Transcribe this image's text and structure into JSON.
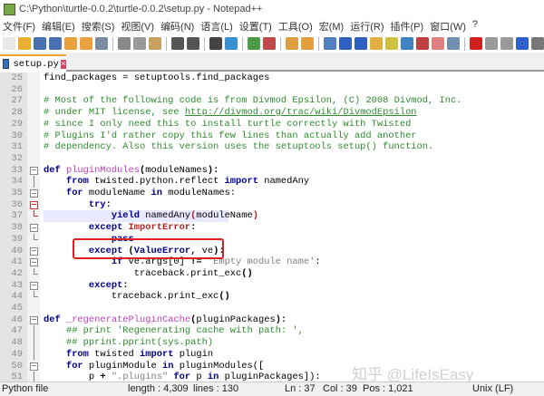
{
  "window": {
    "title": "C:\\Python\\turtle-0.0.2\\turtle-0.0.2\\setup.py - Notepad++"
  },
  "menu": [
    "文件(F)",
    "编辑(E)",
    "搜索(S)",
    "视图(V)",
    "编码(N)",
    "语言(L)",
    "设置(T)",
    "工具(O)",
    "宏(M)",
    "运行(R)",
    "插件(P)",
    "窗口(W)",
    "?"
  ],
  "toolbar": [
    {
      "icon": "new-file-icon",
      "color": "#e8e8e8"
    },
    {
      "icon": "open-file-icon",
      "color": "#e8b030"
    },
    {
      "icon": "save-icon",
      "color": "#4a70b0"
    },
    {
      "icon": "save-all-icon",
      "color": "#4a70b0"
    },
    {
      "icon": "close-icon",
      "color": "#e8a040"
    },
    {
      "icon": "close-all-icon",
      "color": "#e8a040"
    },
    {
      "icon": "print-icon",
      "color": "#7a8aa0"
    },
    "|",
    {
      "icon": "cut-icon",
      "color": "#888"
    },
    {
      "icon": "copy-icon",
      "color": "#999"
    },
    {
      "icon": "paste-icon",
      "color": "#c8a060"
    },
    "|",
    {
      "icon": "undo-icon",
      "color": "#555"
    },
    {
      "icon": "redo-icon",
      "color": "#555"
    },
    "|",
    {
      "icon": "find-icon",
      "color": "#444"
    },
    {
      "icon": "replace-icon",
      "color": "#3a90d0"
    },
    "|",
    {
      "icon": "zoom-in-icon",
      "color": "#4a9a4a"
    },
    {
      "icon": "zoom-out-icon",
      "color": "#c04a4a"
    },
    "|",
    {
      "icon": "sync-vertical-icon",
      "color": "#e0a040"
    },
    {
      "icon": "sync-horizontal-icon",
      "color": "#e0a040"
    },
    "|",
    {
      "icon": "word-wrap-icon",
      "color": "#5080c0"
    },
    {
      "icon": "show-all-chars-icon",
      "color": "#3060c0"
    },
    {
      "icon": "indent-guide-icon",
      "color": "#3060c0"
    },
    {
      "icon": "udl-icon",
      "color": "#e0b040"
    },
    {
      "icon": "doc-map-icon",
      "color": "#d0c040"
    },
    {
      "icon": "function-list-icon",
      "color": "#4080c0"
    },
    {
      "icon": "folder-workspace-icon",
      "color": "#c04040"
    },
    {
      "icon": "doc-list-icon",
      "color": "#e08080"
    },
    {
      "icon": "monitoring-icon",
      "color": "#7090b0"
    },
    "|",
    {
      "icon": "record-macro-icon",
      "color": "#d02020"
    },
    {
      "icon": "stop-macro-icon",
      "color": "#999"
    },
    {
      "icon": "play-macro-icon",
      "color": "#999"
    },
    {
      "icon": "run-macro-multiple-icon",
      "color": "#3060d0"
    },
    {
      "icon": "save-macro-icon",
      "color": "#777"
    }
  ],
  "tab": {
    "label": "setup.py"
  },
  "code": [
    {
      "n": "25",
      "fold": "",
      "segs": [
        [
          "n",
          "find_packages = setuptools.find_packages"
        ]
      ]
    },
    {
      "n": "26",
      "fold": "",
      "segs": []
    },
    {
      "n": "27",
      "fold": "",
      "segs": [
        [
          "c",
          "# Most of the following code is from Divmod Epsilon, (C) 2008 Divmod, Inc."
        ]
      ]
    },
    {
      "n": "28",
      "fold": "",
      "segs": [
        [
          "c",
          "# under MIT license, see "
        ],
        [
          "u",
          "http://divmod.org/trac/wiki/DivmodEpsilon"
        ]
      ]
    },
    {
      "n": "29",
      "fold": "",
      "segs": [
        [
          "c",
          "# since I only need this to install turtle correctly with Twisted"
        ]
      ]
    },
    {
      "n": "30",
      "fold": "",
      "segs": [
        [
          "c",
          "# Plugins I'd rather copy this few lines than actually add another"
        ]
      ]
    },
    {
      "n": "31",
      "fold": "",
      "segs": [
        [
          "c",
          "# dependency. Also this version uses the setuptools setup() function."
        ]
      ]
    },
    {
      "n": "32",
      "fold": "",
      "segs": []
    },
    {
      "n": "33",
      "fold": "box",
      "segs": [
        [
          "k",
          "def "
        ],
        [
          "f",
          "pluginModules"
        ],
        [
          "o",
          "("
        ],
        [
          "n",
          "moduleNames"
        ],
        [
          "o",
          "):"
        ]
      ]
    },
    {
      "n": "34",
      "fold": "line",
      "segs": [
        [
          "n",
          "    "
        ],
        [
          "k",
          "from"
        ],
        [
          "n",
          " twisted.python.reflect "
        ],
        [
          "k",
          "import"
        ],
        [
          "n",
          " namedAny"
        ]
      ]
    },
    {
      "n": "35",
      "fold": "box",
      "segs": [
        [
          "n",
          "    "
        ],
        [
          "k",
          "for"
        ],
        [
          "n",
          " moduleName "
        ],
        [
          "k",
          "in"
        ],
        [
          "n",
          " moduleNames:"
        ]
      ]
    },
    {
      "n": "36",
      "fold": "box red",
      "segs": [
        [
          "n",
          "        "
        ],
        [
          "k",
          "try"
        ],
        [
          "o",
          ":"
        ]
      ]
    },
    {
      "n": "37",
      "fold": "end red",
      "current": true,
      "segs": [
        [
          "n",
          "            "
        ],
        [
          "k",
          "yield"
        ],
        [
          "n",
          " namedAny"
        ],
        [
          "e",
          "("
        ],
        [
          "n",
          "moduleName"
        ],
        [
          "e",
          ")"
        ]
      ]
    },
    {
      "n": "38",
      "fold": "box",
      "segs": [
        [
          "n",
          "        "
        ],
        [
          "k",
          "except "
        ],
        [
          "e",
          "ImportError"
        ],
        [
          "o",
          ":"
        ]
      ]
    },
    {
      "n": "39",
      "fold": "end",
      "segs": [
        [
          "n",
          "            "
        ],
        [
          "k",
          "pass"
        ]
      ]
    },
    {
      "n": "40",
      "fold": "box",
      "segs": [
        [
          "n",
          "        "
        ],
        [
          "k",
          "except "
        ],
        [
          "o",
          "("
        ],
        [
          "k",
          "ValueError"
        ],
        [
          "o",
          ", "
        ],
        [
          "n",
          "ve"
        ],
        [
          "o",
          "):"
        ]
      ]
    },
    {
      "n": "41",
      "fold": "box",
      "segs": [
        [
          "n",
          "            "
        ],
        [
          "k",
          "if"
        ],
        [
          "n",
          " ve.args[0] "
        ],
        [
          "o",
          "!="
        ],
        [
          "s",
          " 'Empty module name'"
        ],
        [
          "n",
          ":"
        ]
      ]
    },
    {
      "n": "42",
      "fold": "end",
      "segs": [
        [
          "n",
          "                traceback.print_exc"
        ],
        [
          "o",
          "()"
        ]
      ]
    },
    {
      "n": "43",
      "fold": "box",
      "segs": [
        [
          "n",
          "        "
        ],
        [
          "k",
          "except"
        ],
        [
          "o",
          ":"
        ]
      ]
    },
    {
      "n": "44",
      "fold": "end",
      "segs": [
        [
          "n",
          "            traceback.print_exc"
        ],
        [
          "o",
          "()"
        ]
      ]
    },
    {
      "n": "45",
      "fold": "",
      "segs": []
    },
    {
      "n": "46",
      "fold": "box",
      "segs": [
        [
          "k",
          "def "
        ],
        [
          "f",
          "_regeneratePluginCache"
        ],
        [
          "o",
          "("
        ],
        [
          "n",
          "pluginPackages"
        ],
        [
          "o",
          "):"
        ]
      ]
    },
    {
      "n": "47",
      "fold": "line",
      "segs": [
        [
          "n",
          "    "
        ],
        [
          "c",
          "## print 'Regenerating cache with path: ',"
        ]
      ]
    },
    {
      "n": "48",
      "fold": "line",
      "segs": [
        [
          "n",
          "    "
        ],
        [
          "c",
          "## pprint.pprint(sys.path)"
        ]
      ]
    },
    {
      "n": "49",
      "fold": "line",
      "segs": [
        [
          "n",
          "    "
        ],
        [
          "k",
          "from"
        ],
        [
          "n",
          " twisted "
        ],
        [
          "k",
          "import"
        ],
        [
          "n",
          " plugin"
        ]
      ]
    },
    {
      "n": "50",
      "fold": "box",
      "segs": [
        [
          "n",
          "    "
        ],
        [
          "k",
          "for"
        ],
        [
          "n",
          " pluginModule "
        ],
        [
          "k",
          "in"
        ],
        [
          "n",
          " pluginModules(["
        ]
      ]
    },
    {
      "n": "51",
      "fold": "line",
      "segs": [
        [
          "n",
          "        p "
        ],
        [
          "o",
          "+"
        ],
        [
          "s",
          " \".plugins\" "
        ],
        [
          "k",
          "for"
        ],
        [
          "n",
          " p "
        ],
        [
          "k",
          "in"
        ],
        [
          "n",
          " pluginPackages]):"
        ]
      ]
    }
  ],
  "watermark": "知乎 @LifeIsEasy",
  "status": {
    "file_type": "Python file",
    "length": "length : 4,309",
    "lines": "lines : 130",
    "ln": "Ln : 37",
    "col": "Col : 39",
    "pos": "Pos : 1,021",
    "eol": "Unix (LF)"
  }
}
